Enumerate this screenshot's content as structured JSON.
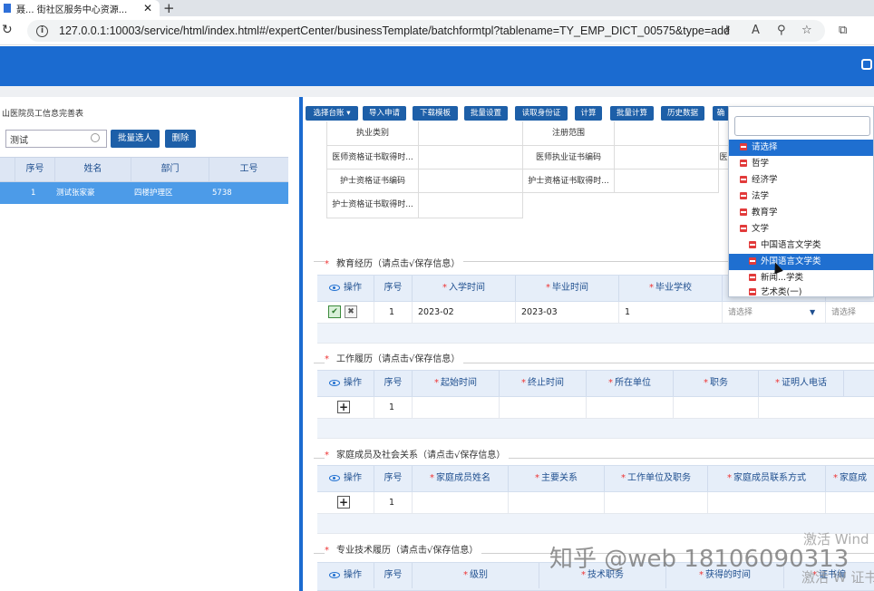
{
  "browser": {
    "tab_title": "聂...  街社区服务中心资源...",
    "new_tab": "+",
    "url": "127.0.0.1:10003/service/html/index.html#/expertCenter/businessTemplate/batchformtpl?tablename=TY_EMP_DICT_00575&type=add&tplType=c..."
  },
  "left_panel": {
    "title": "山医院员工信息完善表",
    "search_value": "测试",
    "batch_button": "批量选人",
    "delete_button": "删除",
    "columns": [
      "序号",
      "姓名",
      "部门",
      "工号"
    ],
    "rows": [
      {
        "index": "1",
        "name": "测试张家豪",
        "dept": "四楼护理区",
        "id": "5738"
      }
    ]
  },
  "toolbar": {
    "buttons": [
      "选择台账 ▾",
      "导入申请",
      "下载模板",
      "批量设置",
      "读取身份证",
      "计算",
      "批量计算",
      "历史数据",
      "确"
    ]
  },
  "cert_grid": {
    "cells": [
      "执业类别",
      "注册范围",
      "医师资格证书取得时...",
      "医师执业证书编码",
      "医",
      "护士资格证书编码",
      "护士资格证书取得时...",
      "护士资格证书取得时..."
    ]
  },
  "edu": {
    "title": "教育经历（请点击√保存信息）",
    "op": "操作",
    "seq": "序号",
    "columns": [
      "入学时间",
      "毕业时间",
      "毕业学校"
    ],
    "ok": "✔",
    "cancel": "✖",
    "row": {
      "index": "1",
      "start": "2023-02",
      "end": "2023-03",
      "school": "1",
      "select1": "请选择",
      "select2": "请选择"
    }
  },
  "work": {
    "title": "工作履历（请点击√保存信息）",
    "op": "操作",
    "seq": "序号",
    "columns": [
      "起始时间",
      "终止时间",
      "所在单位",
      "职务",
      "证明人电话"
    ],
    "plus": "+",
    "row_index": "1"
  },
  "family": {
    "title": "家庭成员及社会关系（请点击√保存信息）",
    "op": "操作",
    "seq": "序号",
    "columns": [
      "家庭成员姓名",
      "主要关系",
      "工作单位及职务",
      "家庭成员联系方式",
      "家庭成"
    ],
    "plus": "+",
    "row_index": "1"
  },
  "tech": {
    "title": "专业技术履历（请点击√保存信息）",
    "op": "操作",
    "seq": "序号",
    "columns": [
      "级别",
      "技术职务",
      "获得的时间",
      "证书编"
    ]
  },
  "dropdown": {
    "items": [
      "请选择",
      "哲学",
      "经济学",
      "法学",
      "教育学",
      "文学",
      "中国语言文学类",
      "外国语言文学类",
      "新闻...学类",
      "艺术类(一)"
    ]
  },
  "overlays": {
    "watermark": "知乎 @web 18106090313",
    "activate1": "激活 Wind",
    "activate2": "激活 W 证书编"
  }
}
